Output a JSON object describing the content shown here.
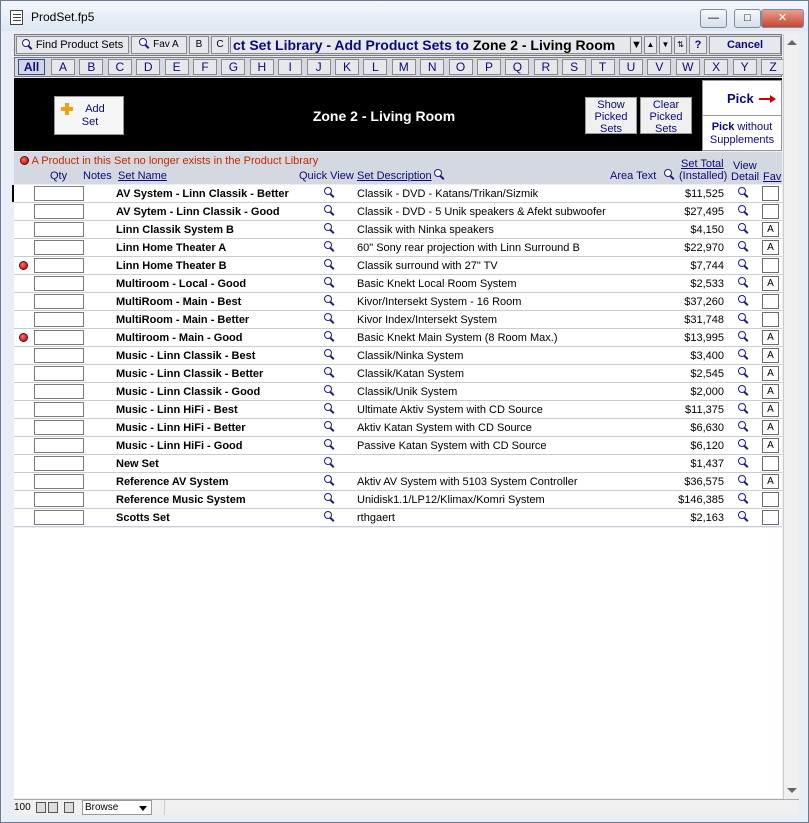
{
  "window": {
    "title": "ProdSet.fp5"
  },
  "toolbar": {
    "find_label": "Find Product Sets",
    "fav_label": "Fav A",
    "b_label": "B",
    "c_label": "C",
    "title_prefix": "ct Set Library - Add Product Sets to ",
    "title_zone": "Zone 2 - Living Room",
    "help_label": "?",
    "cancel_label": "Cancel"
  },
  "alphabet": {
    "all_label": "All",
    "letters": [
      "A",
      "B",
      "C",
      "D",
      "E",
      "F",
      "G",
      "H",
      "I",
      "J",
      "K",
      "L",
      "M",
      "N",
      "O",
      "P",
      "Q",
      "R",
      "S",
      "T",
      "U",
      "V",
      "W",
      "X",
      "Y",
      "Z"
    ]
  },
  "header": {
    "add_set_line1": "Add",
    "add_set_line2": "Set",
    "zone_title": "Zone 2 - Living Room",
    "show_picked": [
      "Show",
      "Picked",
      "Sets"
    ],
    "clear_picked": [
      "Clear",
      "Picked",
      "Sets"
    ],
    "pick_label": "Pick",
    "pick_no_supp_bold": "Pick",
    "pick_no_supp_rest1": " without",
    "pick_no_supp_rest2": "Supplements"
  },
  "list_header": {
    "notice": "A Product in this Set no longer exists in the Product Library",
    "qty": "Qty",
    "notes": "Notes",
    "set_name": "Set Name",
    "quick_view": "Quick View",
    "set_description": "Set Description",
    "area_text": "Area Text",
    "set_total": "Set Total",
    "installed": "(Installed)",
    "view": "View",
    "detail": "Detail",
    "fav": "Fav"
  },
  "rows": [
    {
      "name": "AV System - Linn Classik - Better",
      "desc": "Classik - DVD - Katans/Trikan/Sizmik",
      "total": "$11,525",
      "missing": false,
      "fav": "",
      "selected": true
    },
    {
      "name": "AV Sytem - Linn Classik - Good",
      "desc": "Classik - DVD - 5 Unik speakers & Afekt subwoofer",
      "total": "$27,495",
      "missing": false,
      "fav": "",
      "selected": false
    },
    {
      "name": "Linn Classik System B",
      "desc": "Classik with Ninka speakers",
      "total": "$4,150",
      "missing": false,
      "fav": "A",
      "selected": false
    },
    {
      "name": "Linn Home Theater A",
      "desc": "60\" Sony rear projection with Linn Surround B",
      "total": "$22,970",
      "missing": false,
      "fav": "A",
      "selected": false
    },
    {
      "name": "Linn Home Theater B",
      "desc": "Classik surround with 27\" TV",
      "total": "$7,744",
      "missing": true,
      "fav": "",
      "selected": false
    },
    {
      "name": "Multiroom - Local - Good",
      "desc": "Basic Knekt Local Room System",
      "total": "$2,533",
      "missing": false,
      "fav": "A",
      "selected": false
    },
    {
      "name": "MultiRoom - Main - Best",
      "desc": "Kivor/Intersekt System - 16 Room",
      "total": "$37,260",
      "missing": false,
      "fav": "",
      "selected": false
    },
    {
      "name": "MultiRoom - Main - Better",
      "desc": "Kivor Index/Intersekt System",
      "total": "$31,748",
      "missing": false,
      "fav": "",
      "selected": false
    },
    {
      "name": "Multiroom - Main - Good",
      "desc": "Basic Knekt Main System (8 Room Max.)",
      "total": "$13,995",
      "missing": true,
      "fav": "A",
      "selected": false
    },
    {
      "name": "Music - Linn Classik - Best",
      "desc": "Classik/Ninka System",
      "total": "$3,400",
      "missing": false,
      "fav": "A",
      "selected": false
    },
    {
      "name": "Music - Linn Classik - Better",
      "desc": "Classik/Katan System",
      "total": "$2,545",
      "missing": false,
      "fav": "A",
      "selected": false
    },
    {
      "name": "Music - Linn Classik - Good",
      "desc": "Classik/Unik System",
      "total": "$2,000",
      "missing": false,
      "fav": "A",
      "selected": false
    },
    {
      "name": "Music - Linn HiFi - Best",
      "desc": "Ultimate Aktiv System with CD Source",
      "total": "$11,375",
      "missing": false,
      "fav": "A",
      "selected": false
    },
    {
      "name": "Music - Linn HiFi - Better",
      "desc": "Aktiv Katan System with CD Source",
      "total": "$6,630",
      "missing": false,
      "fav": "A",
      "selected": false
    },
    {
      "name": "Music - Linn HiFi - Good",
      "desc": "Passive Katan System with CD Source",
      "total": "$6,120",
      "missing": false,
      "fav": "A",
      "selected": false
    },
    {
      "name": "New Set",
      "desc": "",
      "total": "$1,437",
      "missing": false,
      "fav": "",
      "selected": false
    },
    {
      "name": "Reference AV System",
      "desc": "Aktiv AV System with 5103 System Controller",
      "total": "$36,575",
      "missing": false,
      "fav": "A",
      "selected": false
    },
    {
      "name": "Reference Music System",
      "desc": "Unidisk1.1/LP12/Klimax/Komri System",
      "total": "$146,385",
      "missing": false,
      "fav": "",
      "selected": false
    },
    {
      "name": "Scotts Set",
      "desc": "rthgaert",
      "total": "$2,163",
      "missing": false,
      "fav": "",
      "selected": false
    }
  ],
  "status": {
    "zoom": "100",
    "mode": "Browse"
  }
}
